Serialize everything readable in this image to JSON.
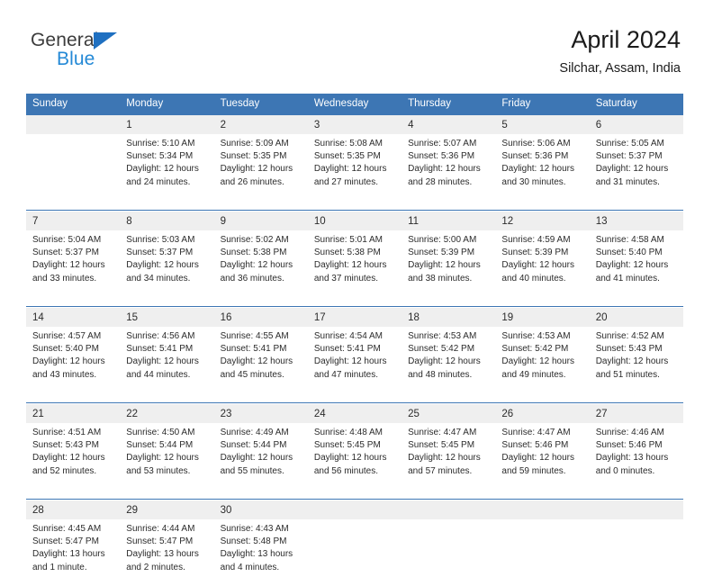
{
  "logo": {
    "word1": "General",
    "word2": "Blue",
    "triangle_icon": "blue-triangle-icon",
    "color_dark": "#3c3c3c",
    "color_blue": "#2489d6"
  },
  "header": {
    "title": "April 2024",
    "subtitle": "Silchar, Assam, India"
  },
  "colors": {
    "header_blue": "#3d76b4",
    "daynum_band": "#efefef",
    "text": "#2b2b2b",
    "page_bg": "#ffffff"
  },
  "weekdays": [
    "Sunday",
    "Monday",
    "Tuesday",
    "Wednesday",
    "Thursday",
    "Friday",
    "Saturday"
  ],
  "weeks": [
    {
      "days": [
        {
          "num": "",
          "l1": "",
          "l2": "",
          "l3": "",
          "l4": ""
        },
        {
          "num": "1",
          "l1": "Sunrise: 5:10 AM",
          "l2": "Sunset: 5:34 PM",
          "l3": "Daylight: 12 hours",
          "l4": "and 24 minutes."
        },
        {
          "num": "2",
          "l1": "Sunrise: 5:09 AM",
          "l2": "Sunset: 5:35 PM",
          "l3": "Daylight: 12 hours",
          "l4": "and 26 minutes."
        },
        {
          "num": "3",
          "l1": "Sunrise: 5:08 AM",
          "l2": "Sunset: 5:35 PM",
          "l3": "Daylight: 12 hours",
          "l4": "and 27 minutes."
        },
        {
          "num": "4",
          "l1": "Sunrise: 5:07 AM",
          "l2": "Sunset: 5:36 PM",
          "l3": "Daylight: 12 hours",
          "l4": "and 28 minutes."
        },
        {
          "num": "5",
          "l1": "Sunrise: 5:06 AM",
          "l2": "Sunset: 5:36 PM",
          "l3": "Daylight: 12 hours",
          "l4": "and 30 minutes."
        },
        {
          "num": "6",
          "l1": "Sunrise: 5:05 AM",
          "l2": "Sunset: 5:37 PM",
          "l3": "Daylight: 12 hours",
          "l4": "and 31 minutes."
        }
      ]
    },
    {
      "days": [
        {
          "num": "7",
          "l1": "Sunrise: 5:04 AM",
          "l2": "Sunset: 5:37 PM",
          "l3": "Daylight: 12 hours",
          "l4": "and 33 minutes."
        },
        {
          "num": "8",
          "l1": "Sunrise: 5:03 AM",
          "l2": "Sunset: 5:37 PM",
          "l3": "Daylight: 12 hours",
          "l4": "and 34 minutes."
        },
        {
          "num": "9",
          "l1": "Sunrise: 5:02 AM",
          "l2": "Sunset: 5:38 PM",
          "l3": "Daylight: 12 hours",
          "l4": "and 36 minutes."
        },
        {
          "num": "10",
          "l1": "Sunrise: 5:01 AM",
          "l2": "Sunset: 5:38 PM",
          "l3": "Daylight: 12 hours",
          "l4": "and 37 minutes."
        },
        {
          "num": "11",
          "l1": "Sunrise: 5:00 AM",
          "l2": "Sunset: 5:39 PM",
          "l3": "Daylight: 12 hours",
          "l4": "and 38 minutes."
        },
        {
          "num": "12",
          "l1": "Sunrise: 4:59 AM",
          "l2": "Sunset: 5:39 PM",
          "l3": "Daylight: 12 hours",
          "l4": "and 40 minutes."
        },
        {
          "num": "13",
          "l1": "Sunrise: 4:58 AM",
          "l2": "Sunset: 5:40 PM",
          "l3": "Daylight: 12 hours",
          "l4": "and 41 minutes."
        }
      ]
    },
    {
      "days": [
        {
          "num": "14",
          "l1": "Sunrise: 4:57 AM",
          "l2": "Sunset: 5:40 PM",
          "l3": "Daylight: 12 hours",
          "l4": "and 43 minutes."
        },
        {
          "num": "15",
          "l1": "Sunrise: 4:56 AM",
          "l2": "Sunset: 5:41 PM",
          "l3": "Daylight: 12 hours",
          "l4": "and 44 minutes."
        },
        {
          "num": "16",
          "l1": "Sunrise: 4:55 AM",
          "l2": "Sunset: 5:41 PM",
          "l3": "Daylight: 12 hours",
          "l4": "and 45 minutes."
        },
        {
          "num": "17",
          "l1": "Sunrise: 4:54 AM",
          "l2": "Sunset: 5:41 PM",
          "l3": "Daylight: 12 hours",
          "l4": "and 47 minutes."
        },
        {
          "num": "18",
          "l1": "Sunrise: 4:53 AM",
          "l2": "Sunset: 5:42 PM",
          "l3": "Daylight: 12 hours",
          "l4": "and 48 minutes."
        },
        {
          "num": "19",
          "l1": "Sunrise: 4:53 AM",
          "l2": "Sunset: 5:42 PM",
          "l3": "Daylight: 12 hours",
          "l4": "and 49 minutes."
        },
        {
          "num": "20",
          "l1": "Sunrise: 4:52 AM",
          "l2": "Sunset: 5:43 PM",
          "l3": "Daylight: 12 hours",
          "l4": "and 51 minutes."
        }
      ]
    },
    {
      "days": [
        {
          "num": "21",
          "l1": "Sunrise: 4:51 AM",
          "l2": "Sunset: 5:43 PM",
          "l3": "Daylight: 12 hours",
          "l4": "and 52 minutes."
        },
        {
          "num": "22",
          "l1": "Sunrise: 4:50 AM",
          "l2": "Sunset: 5:44 PM",
          "l3": "Daylight: 12 hours",
          "l4": "and 53 minutes."
        },
        {
          "num": "23",
          "l1": "Sunrise: 4:49 AM",
          "l2": "Sunset: 5:44 PM",
          "l3": "Daylight: 12 hours",
          "l4": "and 55 minutes."
        },
        {
          "num": "24",
          "l1": "Sunrise: 4:48 AM",
          "l2": "Sunset: 5:45 PM",
          "l3": "Daylight: 12 hours",
          "l4": "and 56 minutes."
        },
        {
          "num": "25",
          "l1": "Sunrise: 4:47 AM",
          "l2": "Sunset: 5:45 PM",
          "l3": "Daylight: 12 hours",
          "l4": "and 57 minutes."
        },
        {
          "num": "26",
          "l1": "Sunrise: 4:47 AM",
          "l2": "Sunset: 5:46 PM",
          "l3": "Daylight: 12 hours",
          "l4": "and 59 minutes."
        },
        {
          "num": "27",
          "l1": "Sunrise: 4:46 AM",
          "l2": "Sunset: 5:46 PM",
          "l3": "Daylight: 13 hours",
          "l4": "and 0 minutes."
        }
      ]
    },
    {
      "days": [
        {
          "num": "28",
          "l1": "Sunrise: 4:45 AM",
          "l2": "Sunset: 5:47 PM",
          "l3": "Daylight: 13 hours",
          "l4": "and 1 minute."
        },
        {
          "num": "29",
          "l1": "Sunrise: 4:44 AM",
          "l2": "Sunset: 5:47 PM",
          "l3": "Daylight: 13 hours",
          "l4": "and 2 minutes."
        },
        {
          "num": "30",
          "l1": "Sunrise: 4:43 AM",
          "l2": "Sunset: 5:48 PM",
          "l3": "Daylight: 13 hours",
          "l4": "and 4 minutes."
        },
        {
          "num": "",
          "l1": "",
          "l2": "",
          "l3": "",
          "l4": ""
        },
        {
          "num": "",
          "l1": "",
          "l2": "",
          "l3": "",
          "l4": ""
        },
        {
          "num": "",
          "l1": "",
          "l2": "",
          "l3": "",
          "l4": ""
        },
        {
          "num": "",
          "l1": "",
          "l2": "",
          "l3": "",
          "l4": ""
        }
      ]
    }
  ]
}
